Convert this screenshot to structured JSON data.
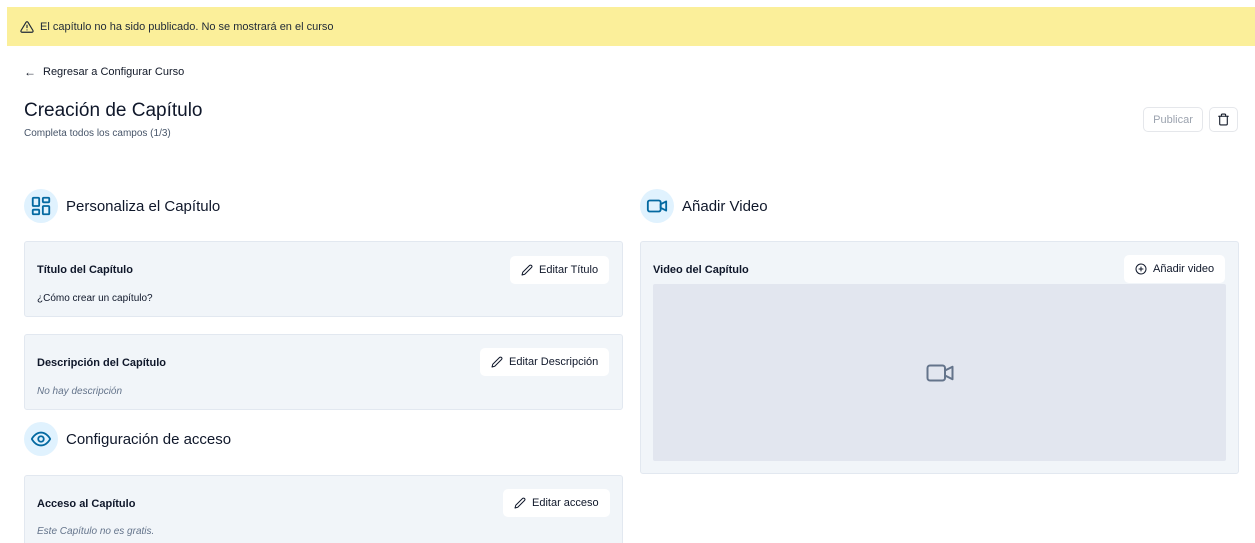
{
  "banner": {
    "text": "El capítulo no ha sido publicado. No se mostrará en el curso"
  },
  "nav": {
    "back_label": "Regresar a Configurar Curso"
  },
  "header": {
    "title": "Creación de Capítulo",
    "subtitle": "Completa todos los campos (1/3)",
    "publish_label": "Publicar"
  },
  "sections": {
    "customize": {
      "title": "Personaliza el Capítulo"
    },
    "access": {
      "title": "Configuración de acceso"
    },
    "video": {
      "title": "Añadir Video"
    }
  },
  "cards": {
    "title": {
      "label": "Título del Capítulo",
      "value": "¿Cómo crear un capítulo?",
      "button": "Editar Título"
    },
    "description": {
      "label": "Descripción del Capítulo",
      "value": "No hay descripción",
      "button": "Editar Descripción"
    },
    "access": {
      "label": "Acceso al Capítulo",
      "value": "Este Capítulo no es gratis.",
      "button": "Editar acceso"
    },
    "video": {
      "label": "Video del Capítulo",
      "button": "Añadir video"
    }
  },
  "colors": {
    "banner": "#fbef9a",
    "accent": "#0369a1",
    "icon_bg": "#e0f2fe",
    "card_bg": "#f1f5f9"
  }
}
